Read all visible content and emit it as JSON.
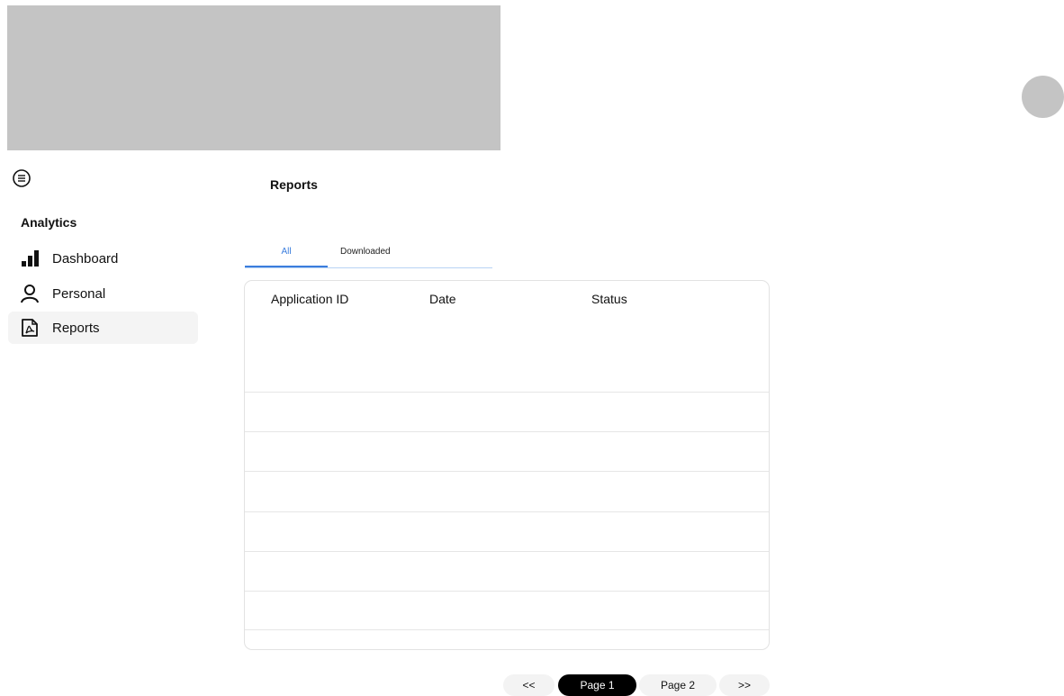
{
  "sidebar": {
    "section_label": "Analytics",
    "items": [
      {
        "label": "Dashboard",
        "icon": "bar-chart-icon",
        "active": false
      },
      {
        "label": "Personal",
        "icon": "person-icon",
        "active": false
      },
      {
        "label": "Reports",
        "icon": "pdf-document-icon",
        "active": true
      }
    ]
  },
  "main": {
    "title": "Reports",
    "tabs": [
      {
        "label": "All",
        "active": true
      },
      {
        "label": "Downloaded",
        "active": false
      }
    ],
    "table": {
      "columns": [
        "Application ID",
        "Date",
        "Status"
      ],
      "rows": []
    },
    "pagination": {
      "first": "<<",
      "pages": [
        "Page 1",
        "Page 2"
      ],
      "current": "Page 1",
      "last": ">>"
    }
  },
  "colors": {
    "accent": "#3b7ddd",
    "placeholder": "#c4c4c4",
    "active_page": "#000000"
  }
}
